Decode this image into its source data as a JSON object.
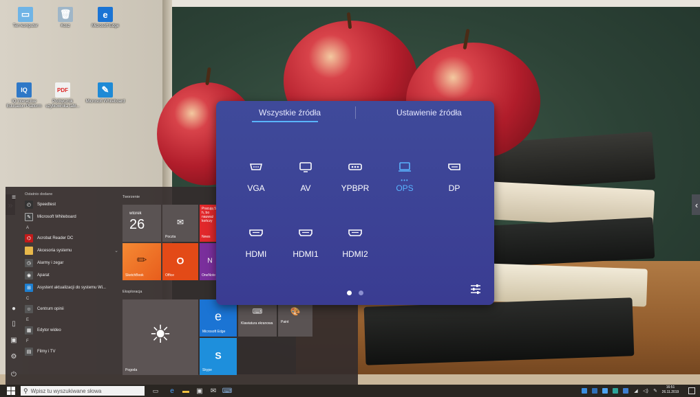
{
  "desktop": {
    "icons": [
      {
        "label": "Ten komputer"
      },
      {
        "label": "Kosz"
      },
      {
        "label": "Microsoft Edge"
      },
      {
        "label": "IQ Interactive Education Platform"
      },
      {
        "label": "Podręcznik użytkownika tabl..."
      },
      {
        "label": "Microsoft Whiteboard"
      }
    ]
  },
  "start_menu": {
    "recent_header": "Ostatnio dodane",
    "apps": {
      "speedtest": "Speedtest",
      "whiteboard": "Microsoft Whiteboard",
      "letter_a": "A",
      "acrobat": "Acrobat Reader DC",
      "accessories": "Akcesoria systemu",
      "alarms": "Alarmy i zegar",
      "camera": "Aparat",
      "update_assistant": "Asystent aktualizacji do systemu Wi...",
      "letter_c": "C",
      "feedback": "Centrum opinii",
      "letter_e": "E",
      "video_editor": "Edytor wideo",
      "letter_f": "F",
      "movies": "Filmy i TV"
    },
    "groups": {
      "create": "Tworzenie",
      "explore": "Eksploracja"
    },
    "tiles": {
      "calendar_day": "wtorek",
      "calendar_date": "26",
      "mail": "Poczta",
      "news": "News",
      "news_text": "Pracują 5,5 h, bo nauważ kończy",
      "sketchbook": "SketchBook",
      "office": "Office",
      "onenote": "OneNote",
      "weather": "Pogoda",
      "edge": "Microsoft Edge",
      "keyboard": "Klawiatura ekranowa",
      "paint": "Paint",
      "skype": "Skype"
    }
  },
  "source_dialog": {
    "tabs": [
      {
        "label": "Wszystkie źródła",
        "active": true
      },
      {
        "label": "Ustawienie źródła",
        "active": false
      }
    ],
    "sources": [
      {
        "label": "VGA",
        "icon": "vga-icon"
      },
      {
        "label": "AV",
        "icon": "av-icon"
      },
      {
        "label": "YPBPR",
        "icon": "ypbpr-icon"
      },
      {
        "label": "OPS",
        "icon": "ops-icon",
        "selected": true,
        "indicator": "•••"
      },
      {
        "label": "DP",
        "icon": "dp-icon"
      },
      {
        "label": "HDMI",
        "icon": "hdmi-icon"
      },
      {
        "label": "HDMI1",
        "icon": "hdmi-icon"
      },
      {
        "label": "HDMI2",
        "icon": "hdmi-icon"
      }
    ],
    "page_current": 1,
    "page_count": 2,
    "accent_color": "#5ab4ff"
  },
  "taskbar": {
    "search_placeholder": "Wpisz tu wyszukiwane słowa",
    "time": "16:51",
    "date": "26.11.2019"
  }
}
